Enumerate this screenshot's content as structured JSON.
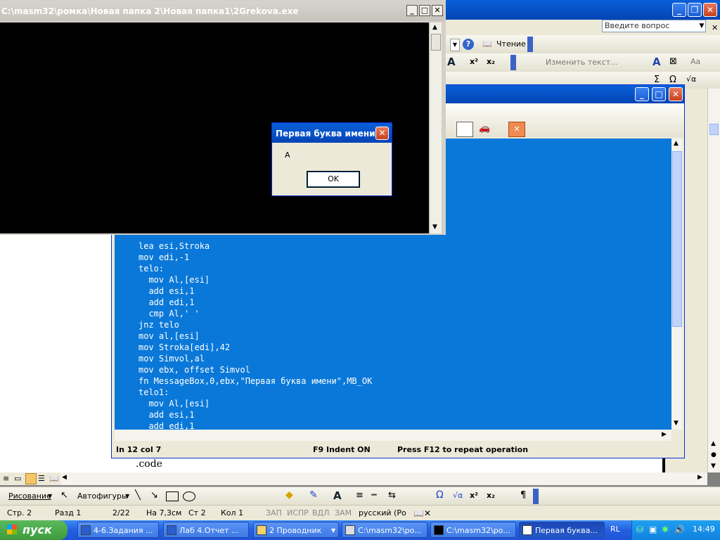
{
  "word": {
    "help_placeholder": "Введите вопрос",
    "toolbar": {
      "reading_label": "Чтение",
      "edit_text_label": "Изменить текст..."
    },
    "doc_code": ".code",
    "drawing_toolbar": {
      "drawing_label": "Рисование",
      "autoshapes_label": "Автофигуры"
    },
    "status": {
      "page": "Стр. 2",
      "section": "Разд 1",
      "pages": "2/22",
      "at": "На 7,3см",
      "line": "Ст 2",
      "col": "Кол 1",
      "rec": "ЗАП",
      "trk": "ИСПР",
      "ext": "ВДЛ",
      "ovr": "ЗАМ",
      "language": "русский (Ро"
    }
  },
  "console": {
    "title": "C:\\masm32\\ромка\\Новая папка 2\\Новая папка1\\2Grekova.exe"
  },
  "editor": {
    "code_lines": [
      "lea esi,Stroka",
      "mov edi,-1",
      "telo:",
      "  mov Al,[esi]",
      "  add esi,1",
      "  add edi,1",
      "  cmp Al,' '",
      "jnz telo",
      "mov al,[esi]",
      "mov Stroka[edi],42",
      "mov Simvol,al",
      "mov ebx, offset Simvol",
      "fn MessageBox,0,ebx,\"Первая буква имени\",MB_OK",
      "telo1:",
      "  mov Al,[esi]",
      "  add esi,1",
      "  add edi,1"
    ],
    "status": {
      "position": "In 12 col 7",
      "indent": "F9 Indent ON",
      "repeat": "Press F12 to repeat operation"
    }
  },
  "msgbox": {
    "title": "Первая буква имени",
    "text": "A",
    "ok_label": "OK"
  },
  "taskbar": {
    "start_label": "пуск",
    "tasks": [
      {
        "label": "4-6.Задания ..."
      },
      {
        "label": "Лаб 4.Отчет ..."
      },
      {
        "label": "2 Проводник"
      },
      {
        "label": "C:\\masm32\\ро..."
      },
      {
        "label": "C:\\masm32\\ро..."
      },
      {
        "label": "Первая буква..."
      }
    ],
    "lang": "RL",
    "clock": "14:49"
  }
}
